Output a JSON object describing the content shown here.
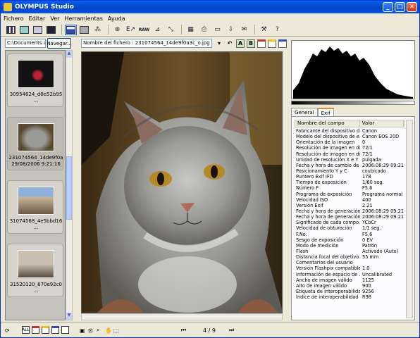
{
  "window": {
    "title": "OLYMPUS Studio"
  },
  "menu": [
    "Fichero",
    "Editar",
    "Ver",
    "Herramientas",
    "Ayuda"
  ],
  "left": {
    "path": "C:\\Documents an",
    "nav_button": "Navegar...",
    "thumbs": [
      {
        "line1": "30954624_d8e52b95",
        "line2": "..."
      },
      {
        "line1": "231074564_14de9f0a",
        "line2": "29/08/2006 9:21:16"
      },
      {
        "line1": "31074568_4e5bbd16",
        "line2": "..."
      },
      {
        "line1": "31520120_670e92c0",
        "line2": "..."
      }
    ]
  },
  "center": {
    "filename": "Nombre del fichero : 231074564_14de9f0a3c_o.jpg",
    "btn_a": "A",
    "btn_b": "B"
  },
  "right": {
    "tabs": [
      "General",
      "Exif"
    ],
    "columns": [
      "Nombre del campo",
      "Valor"
    ],
    "rows": [
      [
        "Fabricante del dispositivo d...",
        "Canon"
      ],
      [
        "Modelo del dispositivo de e...",
        "Canon EOS 20D"
      ],
      [
        "Orientación de la imagen",
        "0"
      ],
      [
        "Resolución de imagen en di...",
        "72/1"
      ],
      [
        "Resolución de imagen en di...",
        "72/1"
      ],
      [
        "Unidad de resolución X e Y",
        "pulgada"
      ],
      [
        "Fecha y hora de cambio de ...",
        "2006:08:29 09:21:1"
      ],
      [
        "Posicionamiento Y y C",
        "coubicado"
      ],
      [
        "Puntero Exif IFD",
        "178"
      ],
      [
        "Tiempo de exposición",
        "1/60 seg."
      ],
      [
        "Número F",
        "F5.6"
      ],
      [
        "Programa de exposición",
        "Programa normal"
      ],
      [
        "Velocidad ISO",
        "400"
      ],
      [
        "Versión Exif",
        "2.21"
      ],
      [
        "Fecha y hora de generación...",
        "2006:08:29 09:21:1"
      ],
      [
        "Fecha y hora de generación...",
        "2006:08:29 09:21:1"
      ],
      [
        "Significado de cada compo...",
        "YCbCr"
      ],
      [
        "Velocidad de obturación",
        "1/1 seg."
      ],
      [
        "F.No.",
        "F5,6"
      ],
      [
        "Sesgo de exposición",
        "0 EV"
      ],
      [
        "Modo de medición",
        "Patrón"
      ],
      [
        "Flash",
        "Activado (Auto)"
      ],
      [
        "Distancia focal del objetivo",
        "55 mm"
      ],
      [
        "Comentarios del usuario",
        ""
      ],
      [
        "Versión Flashpix compatible",
        "1.0"
      ],
      [
        "Información de espacio de ...",
        "Uncalibrated"
      ],
      [
        "Ancho de imagen válido",
        "1125"
      ],
      [
        "Alto de imagen válido",
        "900"
      ],
      [
        "Etiqueta de interoperabilidad",
        "9256"
      ],
      [
        "Índice de interoperabilidad",
        "R98"
      ]
    ]
  },
  "status": {
    "page": "4 / 9",
    "all_label": "ALL"
  },
  "colors": {
    "title_bar": "#0a54e0",
    "selected_thumb": "#bdbab2",
    "accent_orange": "#e68b2c"
  }
}
